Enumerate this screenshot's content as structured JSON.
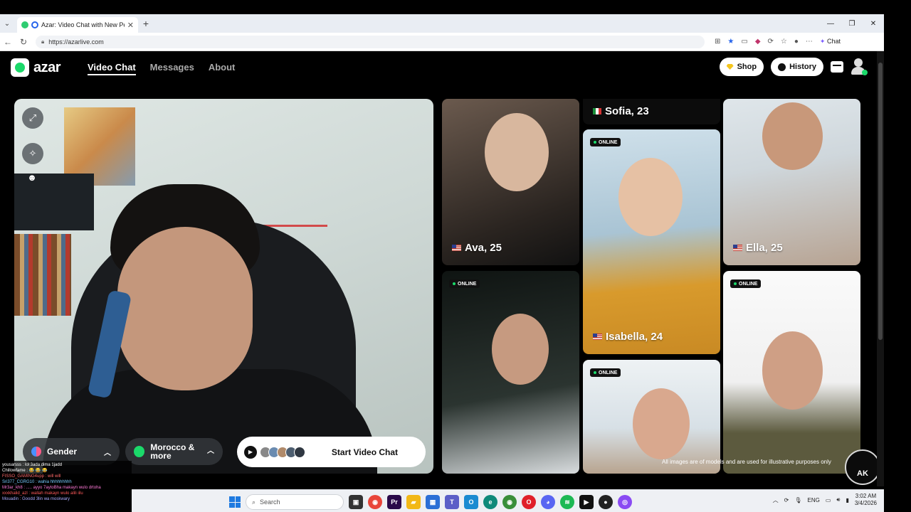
{
  "browser": {
    "tab_title": "Azar: Video Chat with New Pe",
    "url": "https://azarlive.com",
    "chat_label": "Chat"
  },
  "app": {
    "logo": "azar",
    "nav": {
      "video_chat": "Video Chat",
      "messages": "Messages",
      "about": "About"
    },
    "header": {
      "shop": "Shop",
      "history": "History"
    },
    "filters": {
      "gender": "Gender",
      "region": "Morocco & more"
    },
    "start_label": "Start Video Chat",
    "online_label": "ONLINE",
    "disclaimer": "All images are of models and are used for illustrative purposes only",
    "cards": {
      "ava": "Ava, 25",
      "sofia": "Sofia, 23",
      "ella": "Ella, 25",
      "isabella": "Isabella, 24"
    },
    "watermark": "AK"
  },
  "chat_overlay": [
    "yousarsss : lol 3ada dima 1jadd",
    "Chillowfame : 😂 😂 😂",
    "FISSO_GAMING4upp : will will",
    "Sri377_CGRG10 : wahia hhhhhhhhh",
    "Mr3ar_kh8 : ..... ayyo 7aytoBha makayn wulo drtoha",
    "xxxkhalid_azl : wallah makayn wulo alili iilu",
    "Mouadin : Goodd 3lin wa moskwary"
  ],
  "taskbar": {
    "search_placeholder": "Search",
    "lang": "ENG",
    "time": "3:02 AM",
    "date": "3/4/2026"
  },
  "colors": {
    "accent": "#1bd96a",
    "online": "#1bd96a",
    "shop_icon": "#f4c51d"
  }
}
